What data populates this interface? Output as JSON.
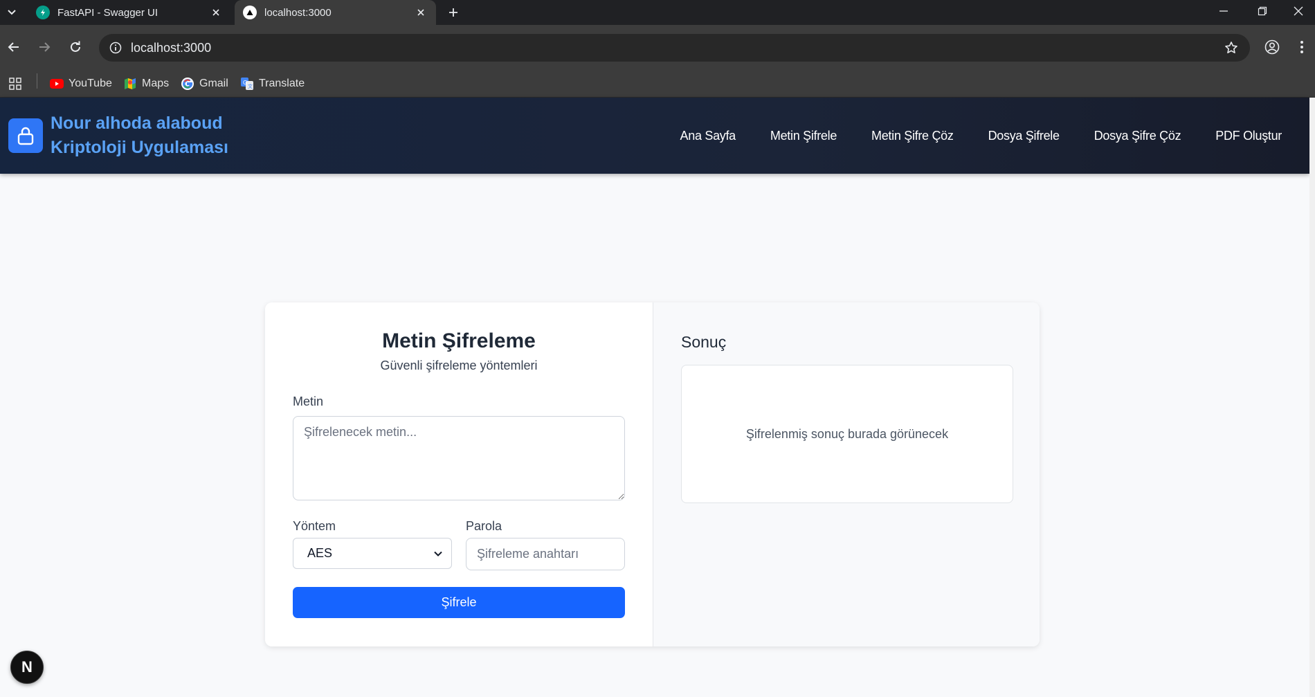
{
  "browser": {
    "tabs": [
      {
        "title": "FastAPI - Swagger UI",
        "active": false,
        "favicon": "fastapi-icon"
      },
      {
        "title": "localhost:3000",
        "active": true,
        "favicon": "nextjs-triangle-icon"
      }
    ],
    "address": "localhost:3000",
    "bookmarks": [
      {
        "label": "YouTube",
        "icon": "youtube-icon"
      },
      {
        "label": "Maps",
        "icon": "maps-icon"
      },
      {
        "label": "Gmail",
        "icon": "google-icon"
      },
      {
        "label": "Translate",
        "icon": "translate-icon"
      }
    ]
  },
  "navbar": {
    "brand_line1": "Nour alhoda alaboud",
    "brand_line2": "Kriptoloji Uygulaması",
    "links": [
      "Ana Sayfa",
      "Metin Şifrele",
      "Metin Şifre Çöz",
      "Dosya Şifrele",
      "Dosya Şifre Çöz",
      "PDF Oluştur"
    ]
  },
  "form": {
    "title": "Metin Şifreleme",
    "subtitle": "Güvenli şifreleme yöntemleri",
    "text_label": "Metin",
    "text_placeholder": "Şifrelenecek metin...",
    "method_label": "Yöntem",
    "method_value": "AES",
    "password_label": "Parola",
    "password_placeholder": "Şifreleme anahtarı",
    "submit_label": "Şifrele"
  },
  "result": {
    "title": "Sonuç",
    "placeholder": "Şifrelenmiş sonuç burada görünecek"
  },
  "dev_badge": "N",
  "colors": {
    "primary": "#1664ff",
    "brand_text": "#5aa2f5",
    "navbar_bg": "#16253f"
  }
}
